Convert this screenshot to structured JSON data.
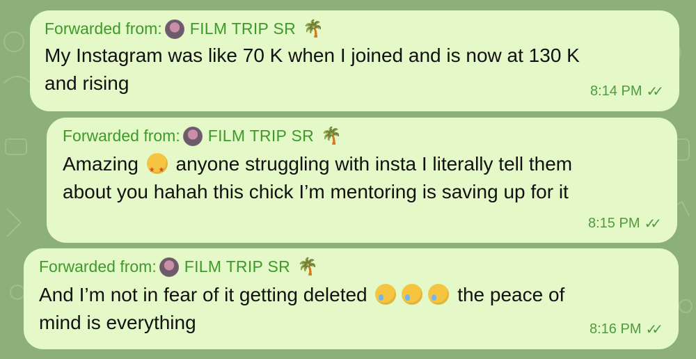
{
  "messages": [
    {
      "forward_label": "Forwarded from:",
      "forward_name": "FILM TRIP SR",
      "lines": [
        "My Instagram was like 70 K when I joined and is now at 130 K",
        "and rising"
      ],
      "time": "8:14 PM"
    },
    {
      "forward_label": "Forwarded from:",
      "forward_name": "FILM TRIP SR",
      "line1_a": "Amazing",
      "line1_b": "anyone struggling with insta I literally tell them",
      "line2": "about you hahah this chick I’m mentoring is saving up for it",
      "time": "8:15 PM"
    },
    {
      "forward_label": "Forwarded from:",
      "forward_name": "FILM TRIP SR",
      "line1_a": "And I’m not in fear of it getting deleted",
      "line1_b": "the peace of",
      "line2": "mind is everything",
      "time": "8:16 PM"
    }
  ],
  "icons": {
    "palm": "🌴",
    "read_receipt": "double-check-icon"
  },
  "colors": {
    "background": "#8db07a",
    "bubble": "#e4f8c8",
    "accent": "#3d9a2a"
  }
}
